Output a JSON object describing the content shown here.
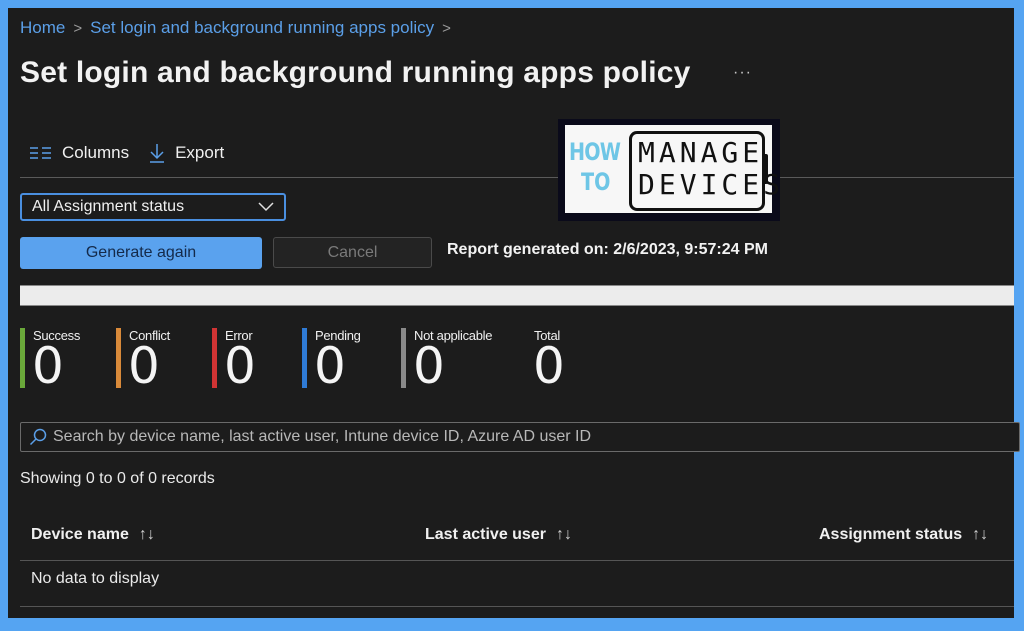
{
  "breadcrumb": [
    {
      "label": "Home"
    },
    {
      "label": "Set login and background running apps policy"
    }
  ],
  "page_title": "Set login and background running apps policy",
  "more_label": "···",
  "toolbar": {
    "columns_label": "Columns",
    "columns_icon": "columns-icon",
    "export_label": "Export",
    "export_icon": "download-icon"
  },
  "logo": {
    "line1_left": "HOW",
    "line2_left": "TO",
    "line1_right": "MANAGE",
    "line2_right": "DEVICES"
  },
  "filter": {
    "selected": "All Assignment status"
  },
  "actions": {
    "generate_label": "Generate again",
    "cancel_label": "Cancel",
    "report_text": "Report generated on: 2/6/2023, 9:57:24 PM"
  },
  "stats": [
    {
      "label": "Success",
      "value": "0",
      "color": "#6aa83a"
    },
    {
      "label": "Conflict",
      "value": "0",
      "color": "#d98a3a"
    },
    {
      "label": "Error",
      "value": "0",
      "color": "#d13434"
    },
    {
      "label": "Pending",
      "value": "0",
      "color": "#2f7bd6"
    },
    {
      "label": "Not applicable",
      "value": "0",
      "color": "#8a8a8a"
    },
    {
      "label": "Total",
      "value": "0",
      "color": null
    }
  ],
  "search": {
    "placeholder": "Search by device name, last active user, Intune device ID, Azure AD user ID"
  },
  "records_text": "Showing 0 to 0 of 0 records",
  "table": {
    "columns": [
      {
        "label": "Device name",
        "sort": "↑↓"
      },
      {
        "label": "Last active user",
        "sort": "↑↓"
      },
      {
        "label": "Assignment status",
        "sort": "↑↓"
      }
    ],
    "empty_text": "No data to display"
  }
}
